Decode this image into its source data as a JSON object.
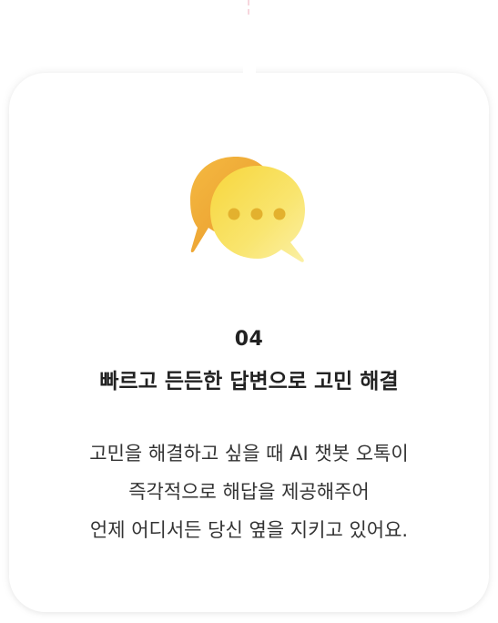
{
  "step": {
    "number": "04",
    "title": "빠르고 든든한 답변으로 고민 해결",
    "description_lines": [
      "고민을 해결하고 싶을 때 AI 챗봇 오톡이",
      "즉각적으로 해답을 제공해주어",
      "언제 어디서든 당신 옆을 지키고 있어요."
    ],
    "icon": "chat-bubbles-icon"
  },
  "colors": {
    "accent_yellow": "#f7d94c",
    "accent_orange": "#f0a93a",
    "text": "#222222"
  }
}
